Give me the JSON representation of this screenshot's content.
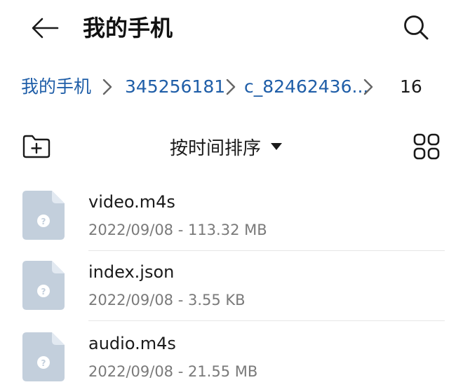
{
  "header": {
    "title": "我的手机",
    "back_icon": "arrow-left-icon",
    "search_icon": "search-icon"
  },
  "breadcrumb": {
    "items": [
      {
        "label": "我的手机"
      },
      {
        "label": "345256181"
      },
      {
        "label": "c_82462436..."
      }
    ],
    "current": "16",
    "link_color": "#1f5ea8"
  },
  "toolbar": {
    "new_folder_icon": "new-folder-icon",
    "sort_label": "按时间排序",
    "sort_icon": "caret-down-icon",
    "view_toggle_icon": "grid-view-icon"
  },
  "files": [
    {
      "name": "video.m4s",
      "meta": "2022/09/08 - 113.32 MB",
      "icon": "unknown-file-icon"
    },
    {
      "name": "index.json",
      "meta": "2022/09/08 - 3.55 KB",
      "icon": "unknown-file-icon"
    },
    {
      "name": "audio.m4s",
      "meta": "2022/09/08 - 21.55 MB",
      "icon": "unknown-file-icon"
    }
  ],
  "colors": {
    "file_icon": "#c3cfdc",
    "file_icon_fold": "#e2e9f1",
    "meta_text": "#7a7a7a"
  }
}
